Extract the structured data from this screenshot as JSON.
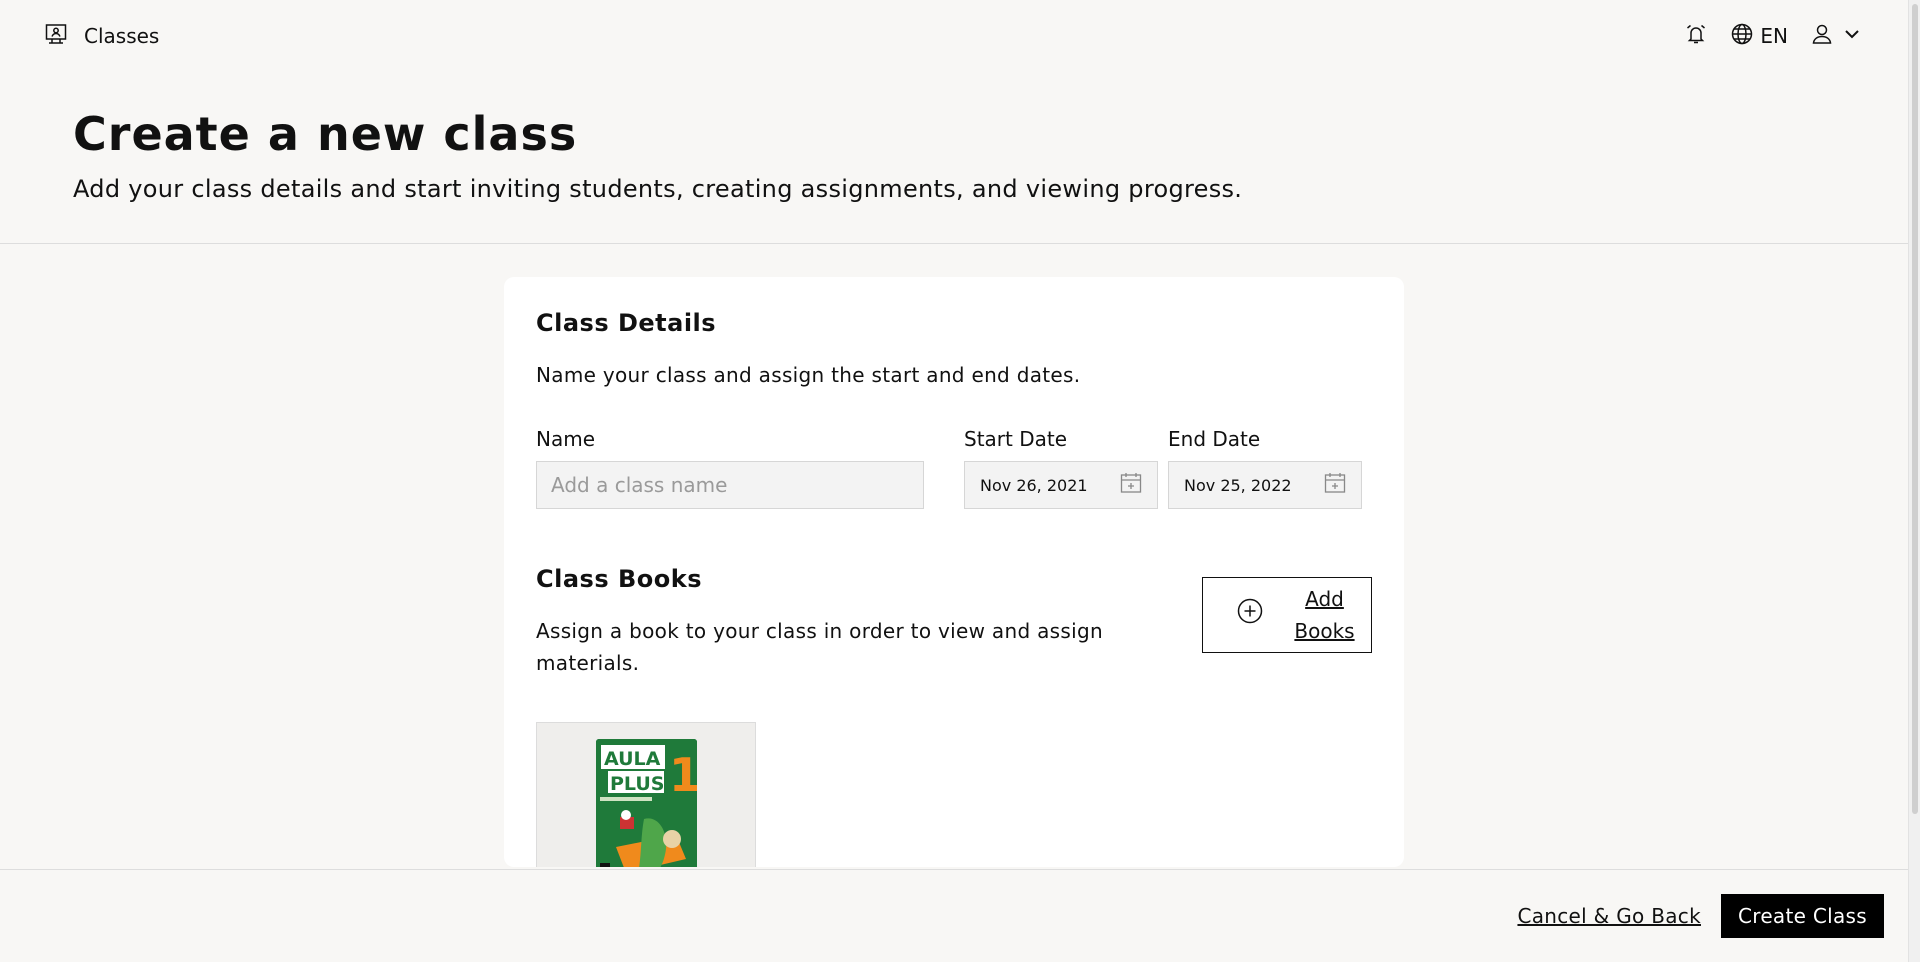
{
  "topbar": {
    "brand_label": "Classes",
    "brand_icon": "classroom-icon",
    "language_label": "EN",
    "icons": [
      "alarm-icon",
      "globe-icon",
      "user-icon",
      "chevron-down-icon"
    ]
  },
  "header": {
    "title": "Create a new class",
    "subtitle": "Add your class details and start inviting students, creating assignments, and viewing progress."
  },
  "class_details": {
    "title": "Class Details",
    "description": "Name your class and assign the start and end dates.",
    "name_label": "Name",
    "name_placeholder": "Add a class name",
    "name_value": "",
    "start_date_label": "Start Date",
    "start_date_value": "Nov 26, 2021",
    "end_date_label": "End Date",
    "end_date_value": "Nov 25, 2022"
  },
  "class_books": {
    "title": "Class Books",
    "description": "Assign a book to your class in order to view and assign materials.",
    "add_label": "Add Books",
    "book_cover": {
      "title_line1": "AULA",
      "title_line2": "PLUS",
      "number": "1",
      "colors": {
        "cover": "#1f7a3a",
        "accent": "#f08a1c"
      }
    }
  },
  "footer": {
    "cancel_label": "Cancel & Go Back",
    "create_label": "Create Class"
  }
}
